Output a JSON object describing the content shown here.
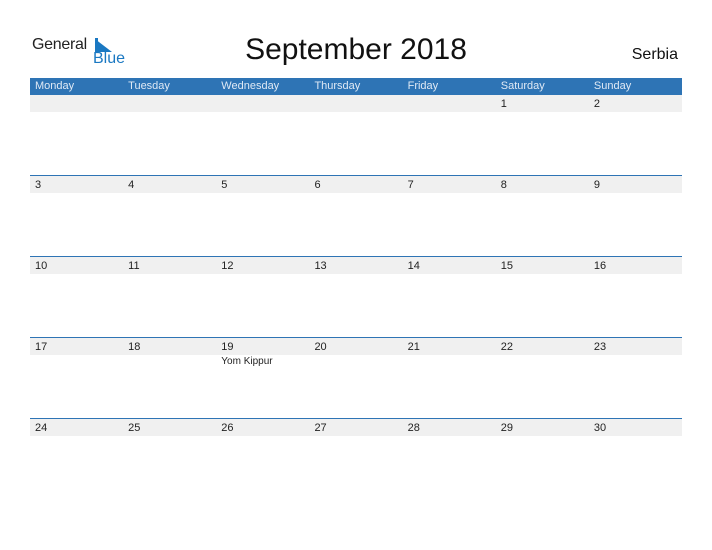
{
  "logo": {
    "word1": "General",
    "word2": "Blue"
  },
  "title": "September 2018",
  "country": "Serbia",
  "colors": {
    "header_bg": "#2e74b5",
    "band_bg": "#f0f0f0",
    "brand_blue": "#1a78c2"
  },
  "weekdays": [
    "Monday",
    "Tuesday",
    "Wednesday",
    "Thursday",
    "Friday",
    "Saturday",
    "Sunday"
  ],
  "weeks": [
    {
      "days": [
        "",
        "",
        "",
        "",
        "",
        "1",
        "2"
      ],
      "events": []
    },
    {
      "days": [
        "3",
        "4",
        "5",
        "6",
        "7",
        "8",
        "9"
      ],
      "events": []
    },
    {
      "days": [
        "10",
        "11",
        "12",
        "13",
        "14",
        "15",
        "16"
      ],
      "events": []
    },
    {
      "days": [
        "17",
        "18",
        "19",
        "20",
        "21",
        "22",
        "23"
      ],
      "events": [
        {
          "col": 2,
          "label": "Yom Kippur"
        }
      ]
    },
    {
      "days": [
        "24",
        "25",
        "26",
        "27",
        "28",
        "29",
        "30"
      ],
      "events": []
    }
  ]
}
